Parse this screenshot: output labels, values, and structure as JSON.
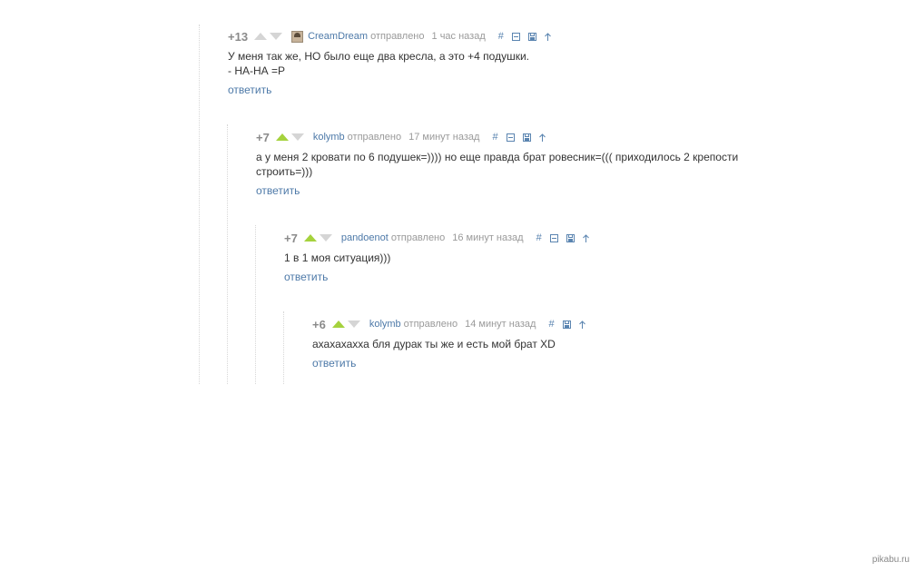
{
  "comments": [
    {
      "rating": "+13",
      "author": "CreamDream",
      "sent": "отправлено",
      "time": "1 час назад",
      "text_lines": [
        "У меня так же, НО было еще два кресла, а это +4 подушки.",
        "- НА-НА =Р"
      ],
      "reply": "ответить",
      "upvoted": false
    },
    {
      "rating": "+7",
      "author": "kolymb",
      "sent": "отправлено",
      "time": "17 минут назад",
      "text_lines": [
        "а у меня 2 кровати по 6 подушек=)))) но еще правда брат ровесник=((( приходилось 2 крепости",
        "строить=)))"
      ],
      "reply": "ответить",
      "upvoted": true
    },
    {
      "rating": "+7",
      "author": "pandoenot",
      "sent": "отправлено",
      "time": "16 минут назад",
      "text_lines": [
        "1 в 1 моя ситуация)))"
      ],
      "reply": "ответить",
      "upvoted": true
    },
    {
      "rating": "+6",
      "author": "kolymb",
      "sent": "отправлено",
      "time": "14 минут назад",
      "text_lines": [
        "ахахахахха бля дурак ты же и есть мой брат XD"
      ],
      "reply": "ответить",
      "upvoted": true
    }
  ],
  "tools": {
    "hash": "#"
  },
  "watermark": "pikabu.ru",
  "colors": {
    "link": "#4d79a8",
    "upvote": "#a5d23d",
    "inactive_arrow": "#d5d5d5"
  }
}
